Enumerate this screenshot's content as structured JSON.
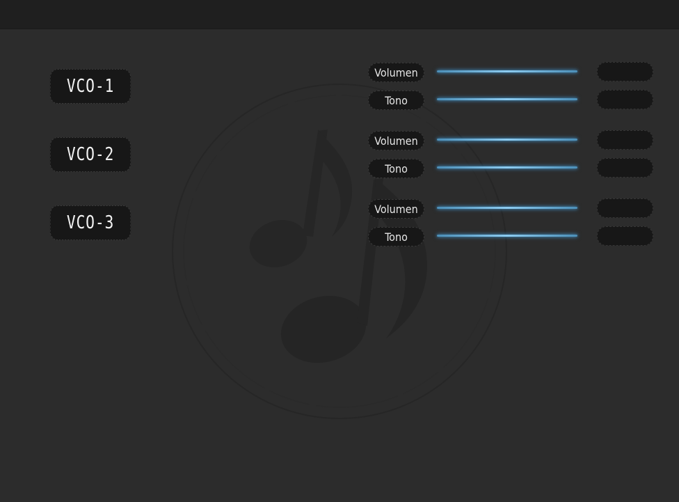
{
  "colors": {
    "background": "#2c2c2c",
    "topbar": "#1f1f1f",
    "control_fill": "#171717",
    "slider_accent": "#8ccbf0",
    "text": "#f2f2f2"
  },
  "watermark": {
    "icon": "music-note-icon"
  },
  "vcos": [
    {
      "name": "VCO-1",
      "params": [
        {
          "label": "Volumen",
          "value": ""
        },
        {
          "label": "Tono",
          "value": ""
        }
      ]
    },
    {
      "name": "VCO-2",
      "params": [
        {
          "label": "Volumen",
          "value": ""
        },
        {
          "label": "Tono",
          "value": ""
        }
      ]
    },
    {
      "name": "VCO-3",
      "params": [
        {
          "label": "Volumen",
          "value": ""
        },
        {
          "label": "Tono",
          "value": ""
        }
      ]
    }
  ]
}
